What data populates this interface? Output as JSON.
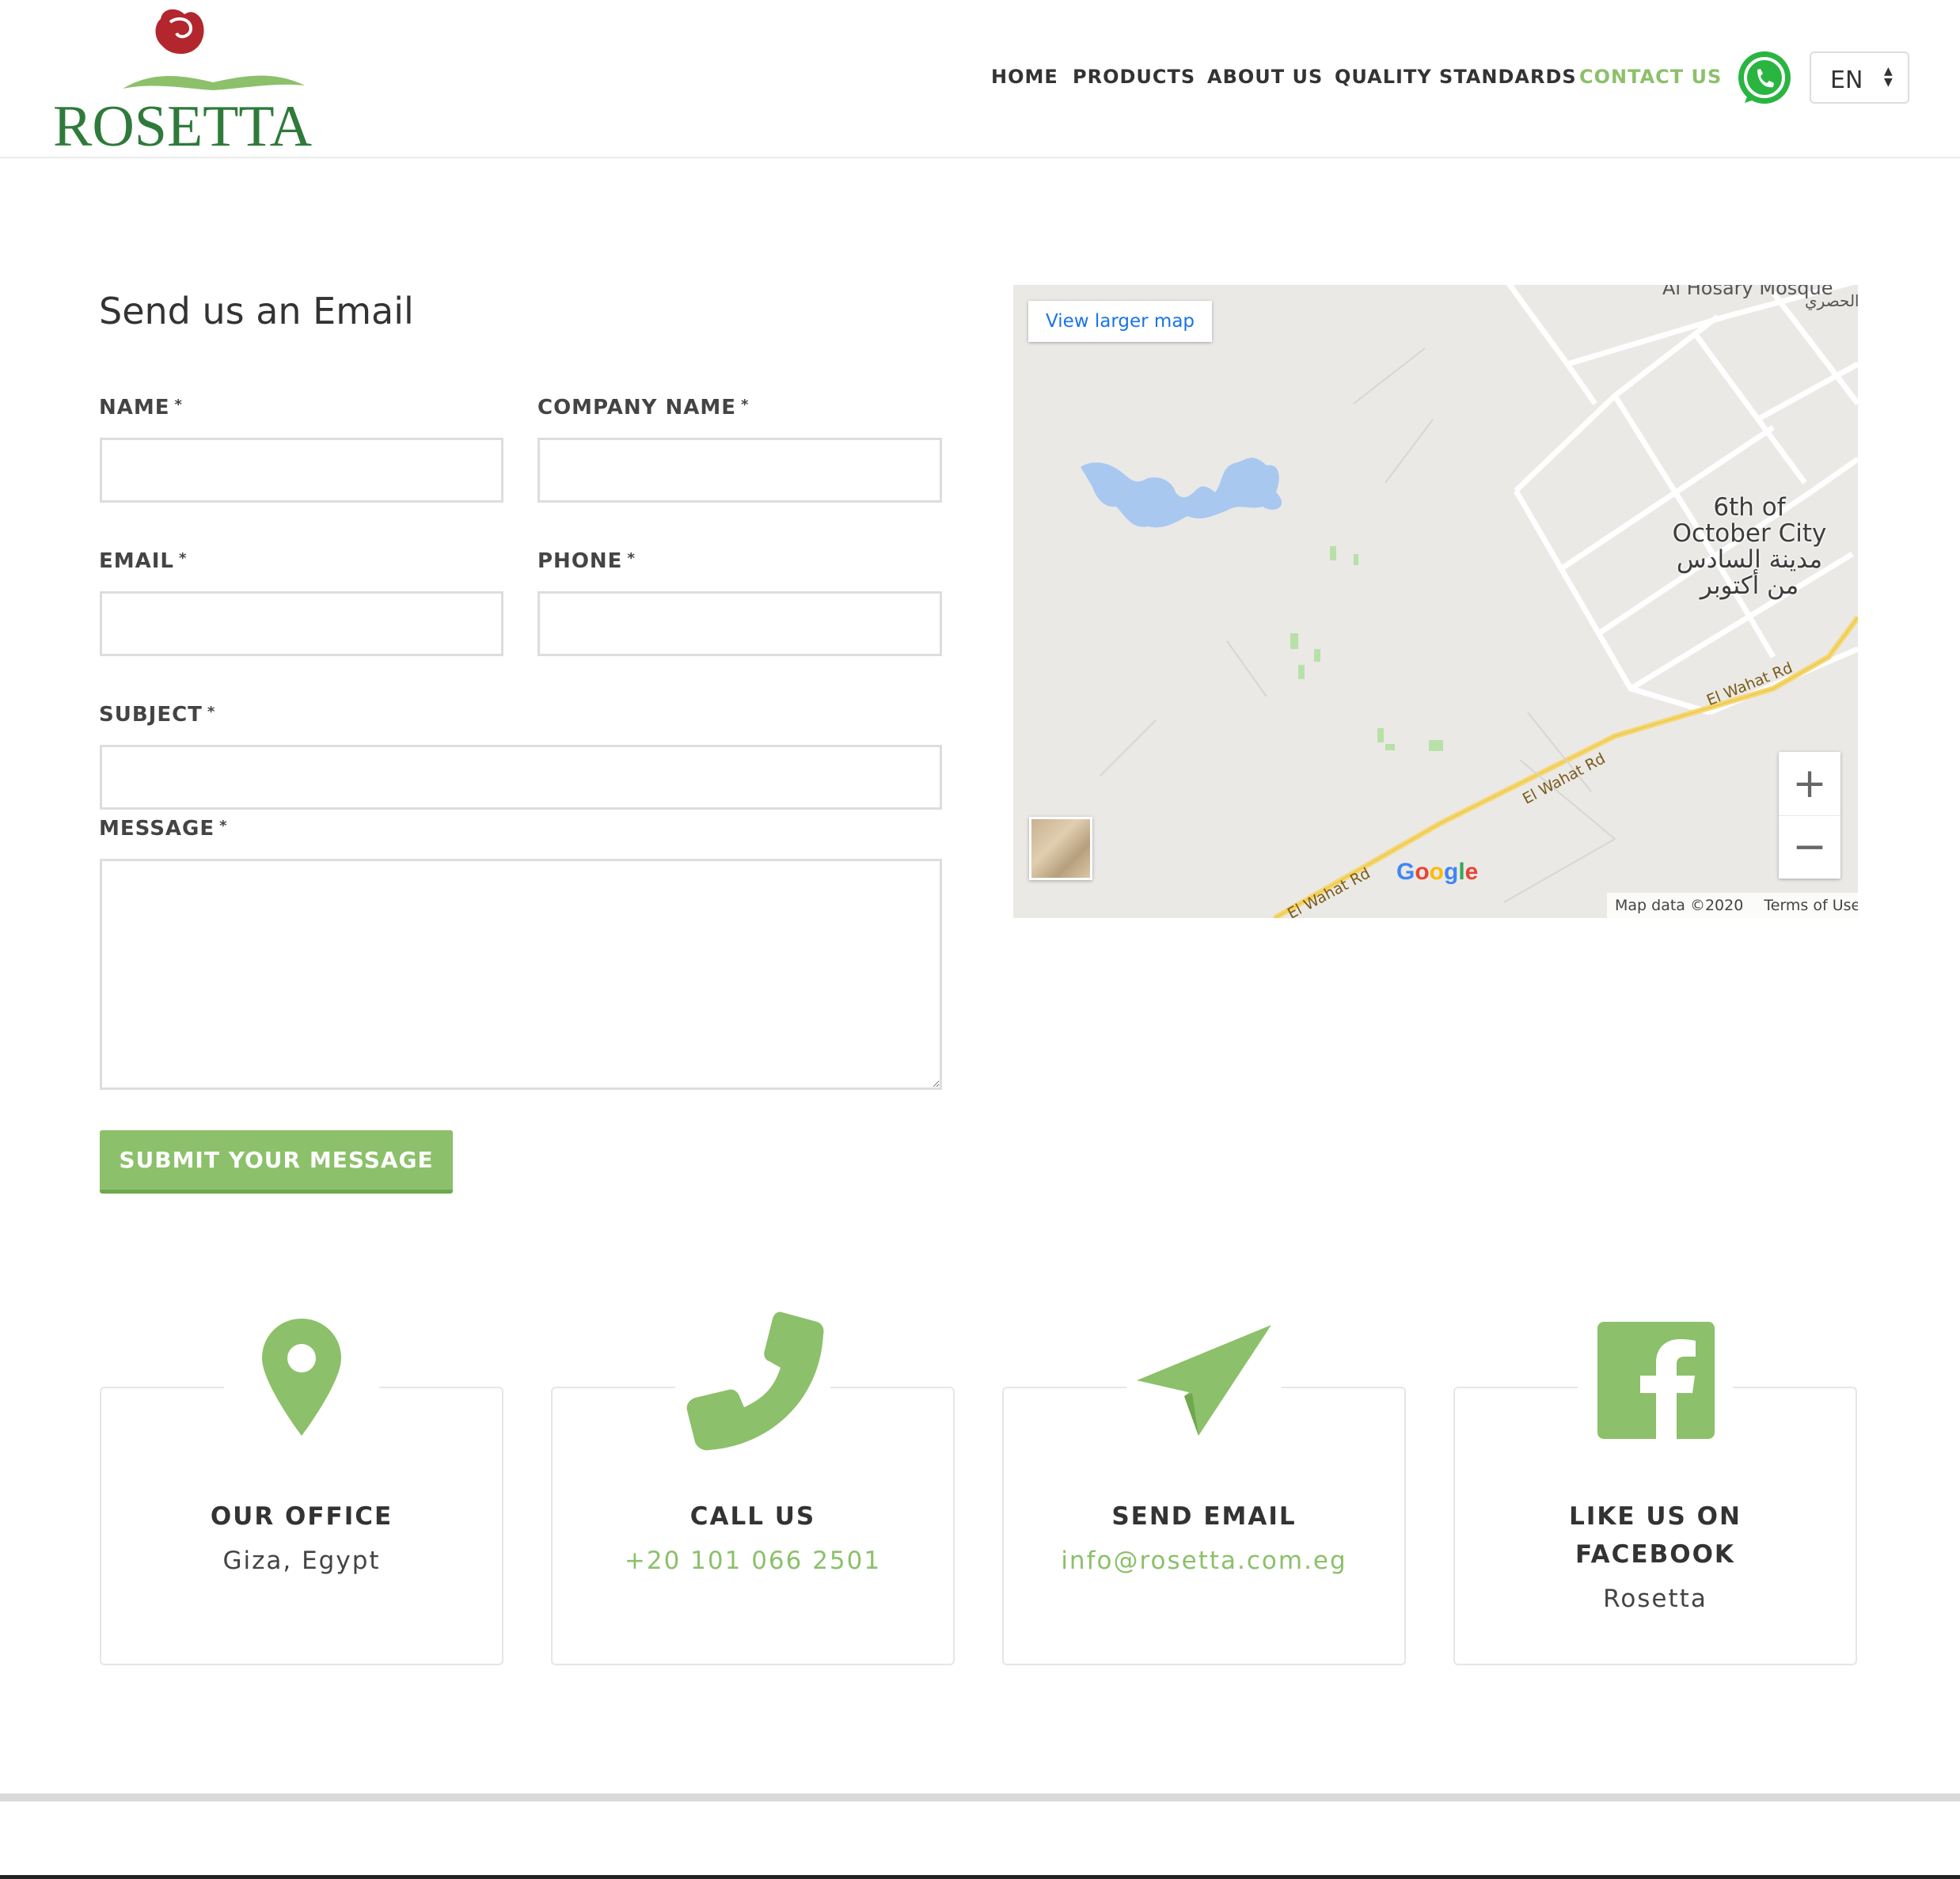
{
  "brand": {
    "name": "ROSETTA"
  },
  "nav": {
    "items": [
      "HOME",
      "PRODUCTS",
      "ABOUT US",
      "QUALITY STANDARDS",
      "CONTACT US"
    ],
    "active": "CONTACT US",
    "language": "EN"
  },
  "form": {
    "title": "Send us an Email",
    "required_mark": "*",
    "labels": {
      "name": "NAME",
      "company": "COMPANY NAME",
      "email": "EMAIL",
      "phone": "PHONE",
      "subject": "SUBJECT",
      "message": "MESSAGE"
    },
    "values": {
      "name": "",
      "company": "",
      "email": "",
      "phone": "",
      "subject": "",
      "message": ""
    },
    "submit_label": "SUBMIT YOUR MESSAGE"
  },
  "map": {
    "view_larger_label": "View larger map",
    "city_en_line1": "6th of",
    "city_en_line2": "October City",
    "city_ar_line1": "مدينة السادس",
    "city_ar_line2": "من أكتوبر",
    "top_label": "Al Hosary Mosque",
    "top_label_ar": "الحصري",
    "road_label": "El Wahat Rd",
    "zoom_in": "+",
    "zoom_out": "−",
    "google": "Google",
    "data_credit": "Map data ©2020",
    "terms": "Terms of Use"
  },
  "cards": [
    {
      "title": "OUR OFFICE",
      "value": "Giza, Egypt",
      "icon": "location-pin-icon"
    },
    {
      "title": "CALL US",
      "value": "+20 101 066 2501",
      "icon": "phone-icon"
    },
    {
      "title": "SEND EMAIL",
      "value": "info@rosetta.com.eg",
      "icon": "paper-plane-icon"
    },
    {
      "title_line1": "LIKE US ON",
      "title_line2": "FACEBOOK",
      "value": "Rosetta",
      "icon": "facebook-icon"
    }
  ],
  "colors": {
    "accent": "#8cc06a",
    "logo_green": "#2f7a3a",
    "logo_red": "#b3262d",
    "text": "#333333"
  }
}
